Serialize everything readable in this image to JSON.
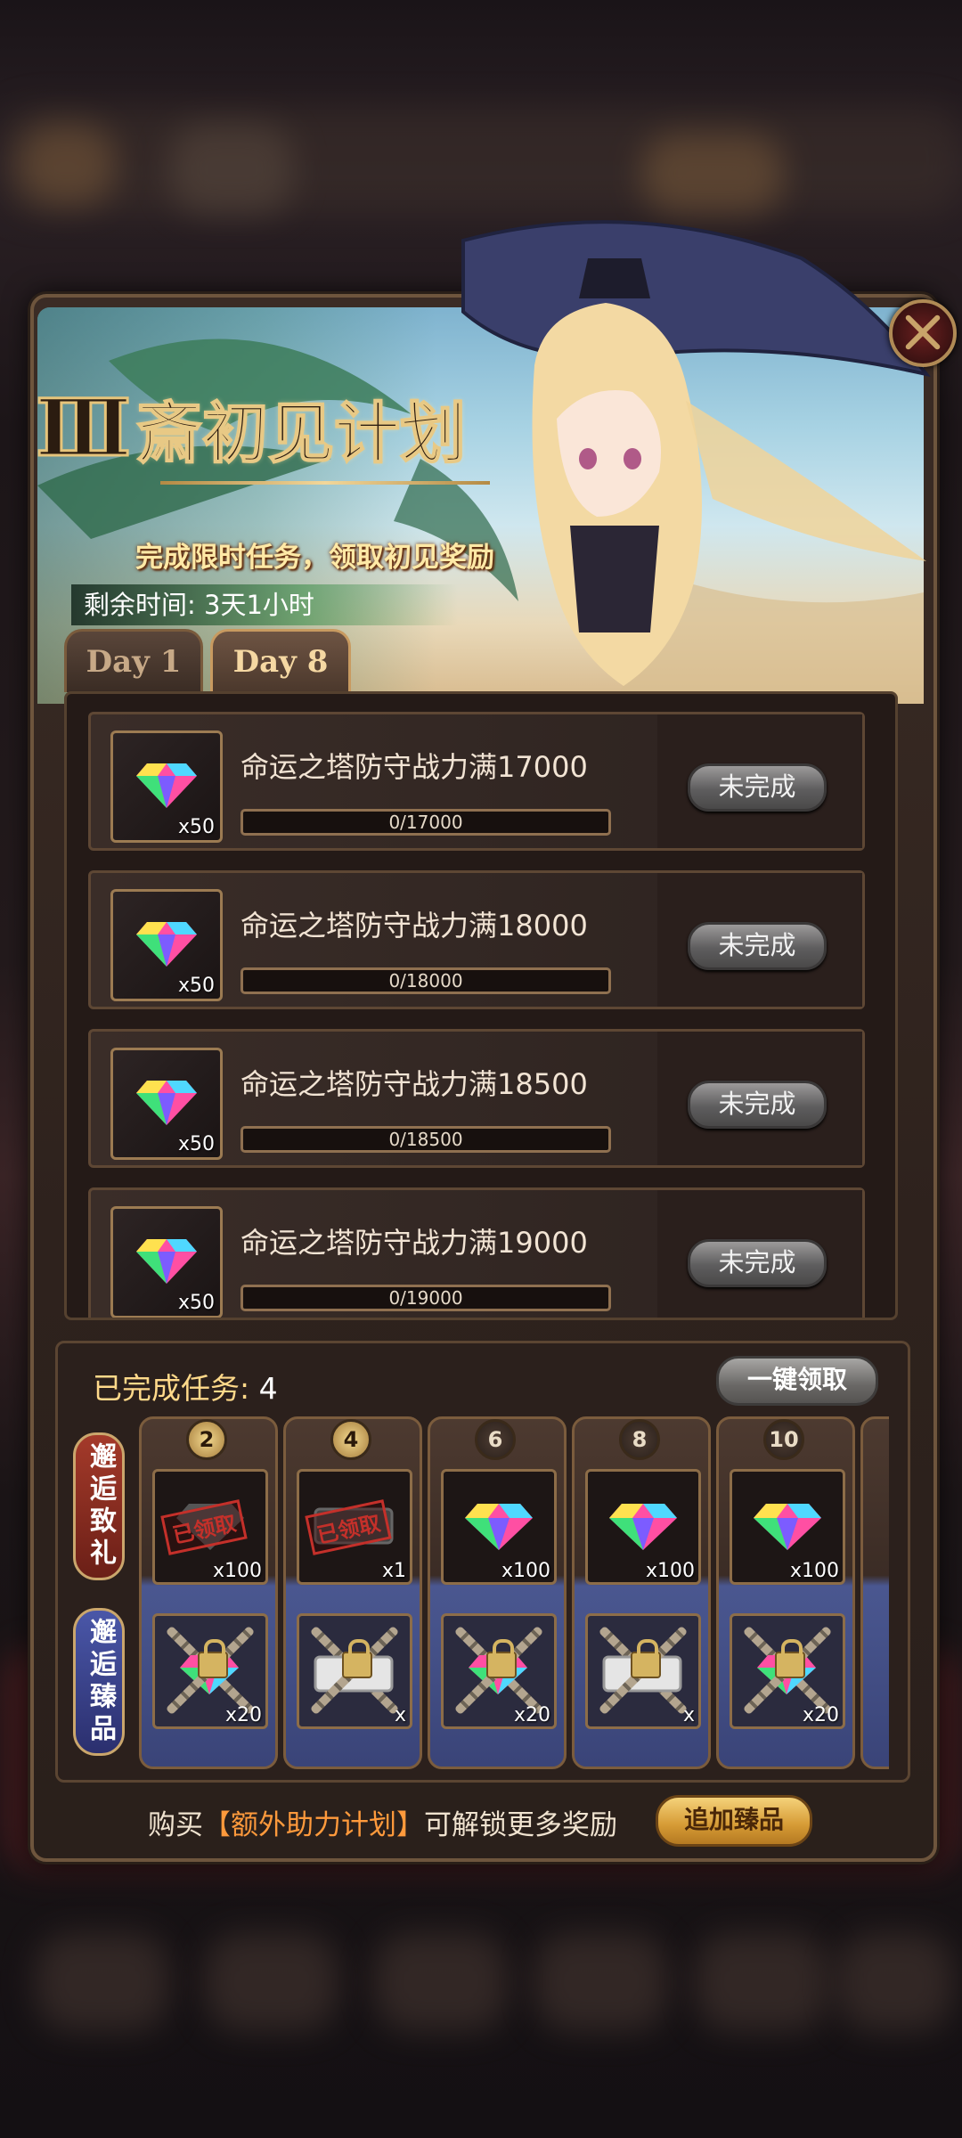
{
  "event": {
    "title_roman": "Ⅲ",
    "title": "斎初见计划",
    "subtitle": "完成限时任务，领取初见奖励",
    "timer_label": "剩余时间: 3天1小时"
  },
  "tabs": [
    {
      "label": "Day 1"
    },
    {
      "label": "Day 8"
    }
  ],
  "tasks": [
    {
      "name": "命运之塔防守战力满17000",
      "progress": "0/17000",
      "qty": "x50",
      "status": "未完成"
    },
    {
      "name": "命运之塔防守战力满18000",
      "progress": "0/18000",
      "qty": "x50",
      "status": "未完成"
    },
    {
      "name": "命运之塔防守战力满18500",
      "progress": "0/18500",
      "qty": "x50",
      "status": "未完成"
    },
    {
      "name": "命运之塔防守战力满19000",
      "progress": "0/19000",
      "qty": "x50",
      "status": "未完成"
    }
  ],
  "completion": {
    "label": "已完成任务:",
    "count": "4",
    "claim_all": "一键领取",
    "side_tab_gift": "邂逅致礼",
    "side_tab_premium": "邂逅臻品",
    "rewards": [
      {
        "num": "2",
        "top_qty": "x100",
        "top_claimed": "已领取",
        "bottom_qty": "x20"
      },
      {
        "num": "4",
        "top_qty": "x1",
        "top_claimed": "已领取",
        "bottom_qty": "x"
      },
      {
        "num": "6",
        "top_qty": "x100",
        "bottom_qty": "x20"
      },
      {
        "num": "8",
        "top_qty": "x100",
        "bottom_qty": "x"
      },
      {
        "num": "10",
        "top_qty": "x100",
        "bottom_qty": "x20"
      }
    ]
  },
  "footer": {
    "prefix": "购买",
    "highlight": "【额外助力计划】",
    "suffix": "可解锁更多奖励",
    "button": "追加臻品"
  },
  "colors": {
    "accent_gold": "#ffd98a",
    "highlight_orange": "#ff9a3c",
    "status_gray": "#6a6866"
  },
  "icons": [
    "close-icon",
    "rainbow-gem-icon",
    "ticket-icon",
    "lock-icon",
    "chain-icon"
  ]
}
